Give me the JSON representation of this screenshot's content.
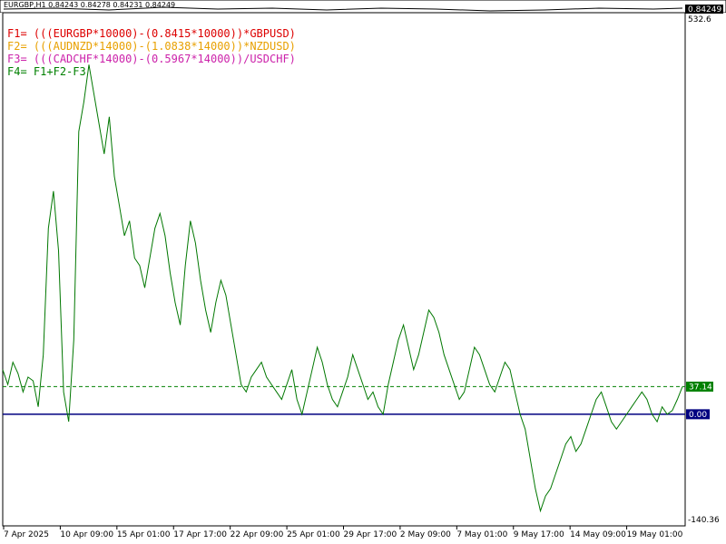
{
  "top_panel": {
    "title": "EURGBP,H1 0.84243 0.84278 0.84231 0.84249",
    "current_price": "0.84249"
  },
  "formulas": [
    {
      "label": "F1=",
      "expr": "(((EURGBP*10000)-(0.8415*10000))*GBPUSD)",
      "color": "#dd0000"
    },
    {
      "label": "F2=",
      "expr": "(((AUDNZD*14000)-(1.0838*14000))*NZDUSD)",
      "color": "#e8a000"
    },
    {
      "label": "F3=",
      "expr": "(((CADCHF*14000)-(0.5967*14000))/USDCHF)",
      "color": "#cc22aa"
    },
    {
      "label": "F4=",
      "expr": "F1+F2-F3",
      "color": "#008000"
    }
  ],
  "colors": {
    "series": "#007700",
    "zero_line": "#000080",
    "current_line": "#008000",
    "current_tag": "#008000",
    "zero_tag": "#000080"
  },
  "chart_data": {
    "type": "line",
    "ylim": [
      -140.36,
      532.6
    ],
    "y_axis_labels": [
      "532.6",
      "-140.36"
    ],
    "current_value": 37.14,
    "current_value_label": "37.14",
    "zero_value": 0,
    "zero_value_label": "0.00",
    "x_tick_labels": [
      "7 Apr 2025",
      "10 Apr 09:00",
      "15 Apr 01:00",
      "17 Apr 17:00",
      "22 Apr 09:00",
      "25 Apr 01:00",
      "29 Apr 17:00",
      "2 May 09:00",
      "7 May 01:00",
      "9 May 17:00",
      "14 May 09:00",
      "19 May 01:00"
    ],
    "series": [
      {
        "values": [
          60,
          40,
          70,
          55,
          30,
          50,
          45,
          10,
          80,
          250,
          300,
          220,
          30,
          -10,
          100,
          380,
          420,
          470,
          430,
          390,
          350,
          400,
          320,
          280,
          240,
          260,
          210,
          200,
          170,
          210,
          250,
          270,
          240,
          190,
          150,
          120,
          200,
          260,
          230,
          180,
          140,
          110,
          150,
          180,
          160,
          120,
          80,
          40,
          30,
          50,
          60,
          70,
          50,
          40,
          30,
          20,
          40,
          60,
          20,
          0,
          30,
          60,
          90,
          70,
          40,
          20,
          10,
          30,
          50,
          80,
          60,
          40,
          20,
          30,
          10,
          0,
          40,
          70,
          100,
          120,
          90,
          60,
          80,
          110,
          140,
          130,
          110,
          80,
          60,
          40,
          20,
          30,
          60,
          90,
          80,
          60,
          40,
          30,
          50,
          70,
          60,
          30,
          0,
          -20,
          -60,
          -100,
          -130,
          -110,
          -100,
          -80,
          -60,
          -40,
          -30,
          -50,
          -40,
          -20,
          0,
          20,
          30,
          10,
          -10,
          -20,
          -10,
          0,
          10,
          20,
          30,
          20,
          0,
          -10,
          10,
          0,
          5,
          20,
          37.14
        ]
      }
    ]
  }
}
